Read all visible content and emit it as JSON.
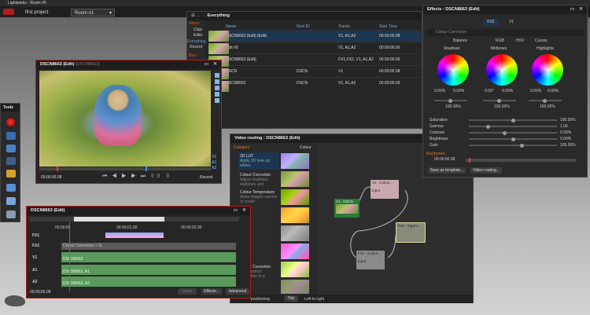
{
  "app": {
    "title": "Lightworks - Room #5",
    "tabs": [
      "first project",
      "Room #1"
    ]
  },
  "tools": {
    "title": "Tools"
  },
  "everything": {
    "title": "Everything",
    "filters": {
      "title": "Filters",
      "items": [
        "Clips",
        "Edits",
        "Everything",
        "Recent"
      ],
      "selected": "Everything",
      "bins": "Bins"
    },
    "columns": [
      "Name",
      "Reel ID",
      "Tracks",
      "Start Time"
    ],
    "rows": [
      {
        "name": "DSCN8663 (Edit) (Edit)",
        "reel": "",
        "tracks": "V1, A1,A2",
        "start": "00:00:00.08"
      },
      {
        "name": "Edit #9",
        "reel": "",
        "tracks": "V1, A1,A2",
        "start": "00:00:00.00"
      },
      {
        "name": "DSCN8663 (Edit)",
        "reel": "",
        "tracks": "FX1,FX2, V1, A1,A2",
        "start": "00:00:00.00"
      },
      {
        "name": "DSCN",
        "reel": "DSCN",
        "tracks": "V1",
        "start": "00:00:00.08"
      },
      {
        "name": "DSCN8663",
        "reel": "DSCN",
        "tracks": "V1, A1,A2",
        "start": "00:00:00.00"
      }
    ]
  },
  "viewer": {
    "title": "DSCN8663 (Edit)",
    "subtitle": "[DSCN8663]",
    "timecode": "00:00:00.08",
    "tracks": [
      "V1",
      "A1",
      "A2"
    ],
    "record": "Record"
  },
  "routing": {
    "title": "Video routing : DSCN8663 (Edit)",
    "category_label": "Category",
    "category_value": "Colour",
    "categories": [
      {
        "name": "3D LUT",
        "desc": "Apply 3D look up tables"
      },
      {
        "name": "Colour Correction",
        "desc": "Adjust shadows, midtones and"
      },
      {
        "name": "Colour Temperature",
        "desc": "Make images warmer or cooler"
      },
      {
        "name": "",
        "desc": ""
      },
      {
        "name": "Colour Correction",
        "desc": "Apply colour correction to a"
      }
    ],
    "nodes": {
      "src": "V1 : DSCN",
      "colour": "V1 : Colour...",
      "input": "Input",
      "fx1": "FX1 : Colour...",
      "input2": "Input",
      "out": "FX1 : Input 1"
    },
    "bottom": {
      "positioning": "positioning",
      "tidy": "Tidy",
      "direction": "Left to right"
    }
  },
  "effects": {
    "title": "Effects : DSCN8663 (Edit)",
    "tabs": [
      "FX2",
      "V1"
    ],
    "subtitle": "Colour Correction",
    "modes": [
      "Balance",
      "RGB",
      "HSV",
      "Curves"
    ],
    "selected_mode": "Balance",
    "subtabs": [
      "Shadows",
      "Midtones",
      "Highlights"
    ],
    "wheel_values": [
      {
        "a": "0.00%",
        "b": "0.00%",
        "c": "100.00%"
      },
      {
        "a": "0.00°",
        "b": "0.00%",
        "c": "100.00%"
      },
      {
        "a": "0.00%",
        "b": "0.00%",
        "c": "100.00%"
      }
    ],
    "params": [
      {
        "name": "Saturation",
        "value": "100.00%",
        "level": 0.5
      },
      {
        "name": "Gamma",
        "value": "1.00",
        "level": 0.2
      },
      {
        "name": "Contrast",
        "value": "0.00%",
        "level": 0.4
      },
      {
        "name": "Brightness",
        "value": "0.00%",
        "level": 0.5
      },
      {
        "name": "Gain",
        "value": "100.00%",
        "level": 0.6
      }
    ],
    "keyframes": "Keyframes",
    "kf_time": "00:00:00.08",
    "buttons": [
      "Save as template...",
      "Video routing..."
    ]
  },
  "timeline": {
    "title": "DSCN8663 (Edit)",
    "ruler": [
      "00:00:00",
      "00:00:01.00",
      "00:00:02.00"
    ],
    "tracks": [
      {
        "label": "FX1",
        "clip": ""
      },
      {
        "label": "FX2",
        "clip": "Colour Correction + 11"
      },
      {
        "label": "V1",
        "clip": "DSCN8663"
      },
      {
        "label": "A1",
        "clip": "DSCN8663, A1"
      },
      {
        "label": "A2",
        "clip": "DSCN8663, A2"
      }
    ],
    "timecode": "00:00:00.08",
    "buttons": [
      "Undo",
      "Effects...",
      "Advanced"
    ]
  },
  "colors": {
    "accent": "#b01d1d",
    "select": "#1d3650",
    "link": "#5aa0e0"
  }
}
